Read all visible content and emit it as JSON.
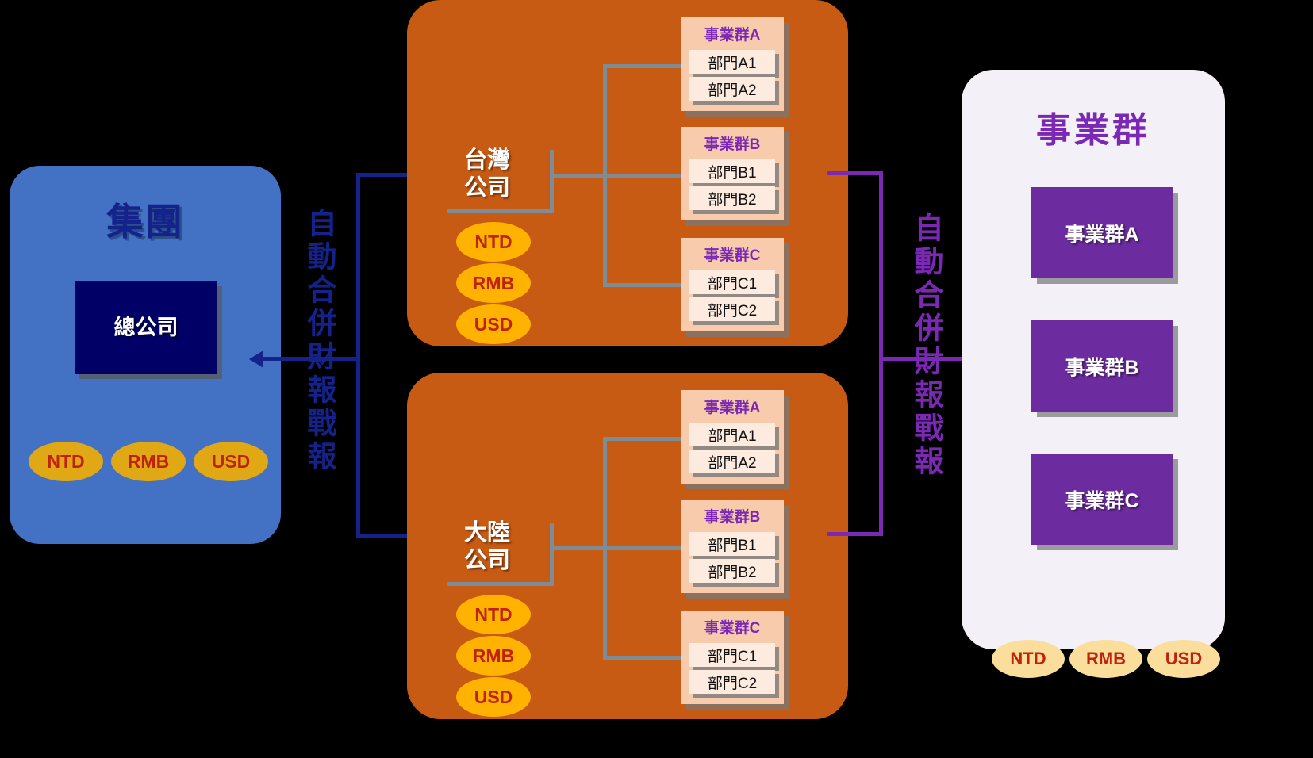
{
  "group_panel": {
    "title": "集團",
    "hq_label": "總公司",
    "currencies": [
      "NTD",
      "RMB",
      "USD"
    ],
    "color": "#4372C4",
    "hq_color": "#000066",
    "title_color": "#14228C"
  },
  "flow_left": {
    "label": "自動合併財報戰報",
    "color": "#14228C",
    "direction": "left"
  },
  "flow_right": {
    "label": "自動合併財報戰報",
    "color": "#7B28B5",
    "direction": "right"
  },
  "companies": [
    {
      "name_line1": "台灣",
      "name_line2": "公司",
      "currencies": [
        "NTD",
        "RMB",
        "USD"
      ],
      "business_units": [
        {
          "title": "事業群A",
          "departments": [
            "部門A1",
            "部門A2"
          ]
        },
        {
          "title": "事業群B",
          "departments": [
            "部門B1",
            "部門B2"
          ]
        },
        {
          "title": "事業群C",
          "departments": [
            "部門C1",
            "部門C2"
          ]
        }
      ]
    },
    {
      "name_line1": "大陸",
      "name_line2": "公司",
      "currencies": [
        "NTD",
        "RMB",
        "USD"
      ],
      "business_units": [
        {
          "title": "事業群A",
          "departments": [
            "部門A1",
            "部門A2"
          ]
        },
        {
          "title": "事業群B",
          "departments": [
            "部門B1",
            "部門B2"
          ]
        },
        {
          "title": "事業群C",
          "departments": [
            "部門C1",
            "部門C2"
          ]
        }
      ]
    }
  ],
  "bu_panel": {
    "title": "事業群",
    "items": [
      "事業群A",
      "事業群B",
      "事業群C"
    ],
    "currencies": [
      "NTD",
      "RMB",
      "USD"
    ],
    "color": "#F3F0F8",
    "box_color": "#6C2CA0",
    "title_color": "#7B28B5"
  },
  "palette": {
    "orange_panel": "#C75B14",
    "card_bg": "#F7CBAC",
    "dept_bg": "#FDEBDF",
    "wire": "#7F8C96"
  }
}
